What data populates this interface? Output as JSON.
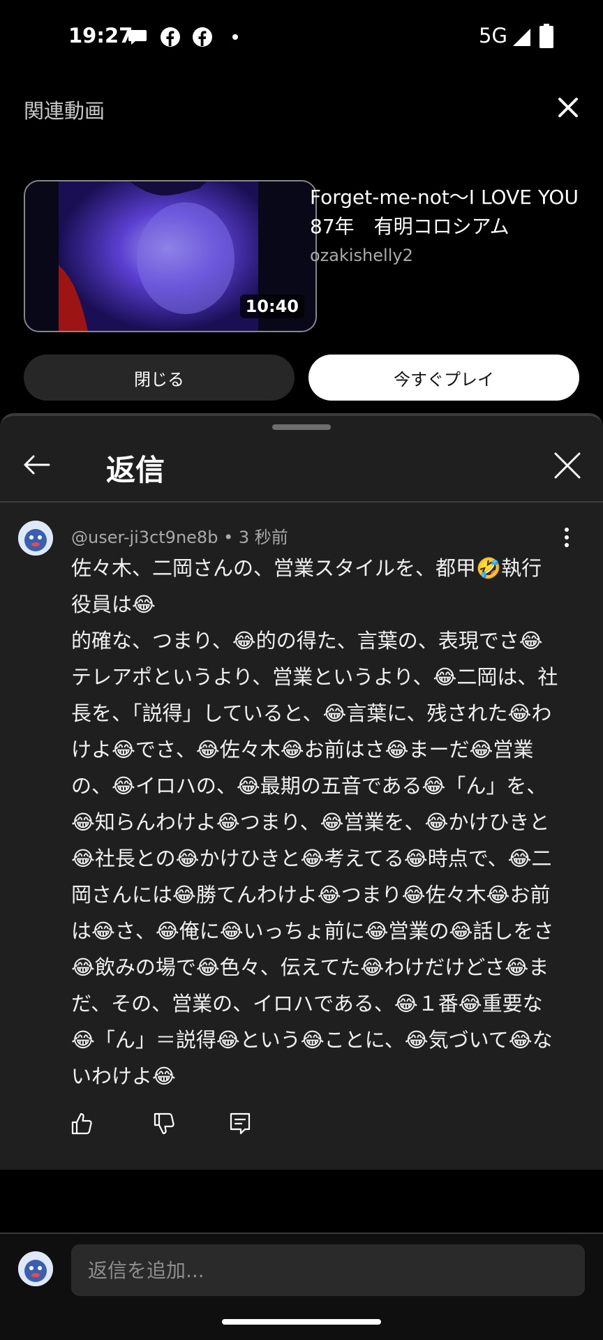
{
  "status_bar": {
    "time": "19:27",
    "notification_icons": [
      "chat-bubble-icon",
      "facebook-icon",
      "facebook-icon",
      "dot-icon"
    ],
    "network": "5G"
  },
  "related": {
    "title": "関連動画",
    "video": {
      "title": "Forget-me-not〜I LOVE YOU\n87年　有明コロシアム",
      "channel": "ozakishelly2",
      "duration": "10:40"
    },
    "close_button": "閉じる",
    "play_button": "今すぐプレイ"
  },
  "replies_sheet": {
    "title": "返信",
    "comment": {
      "meta": "@user-ji3ct9ne8b • 3 秒前",
      "text": "佐々木、二岡さんの、営業スタイルを、都甲🤣執行役員は😂\n的確な、つまり、😂的の得た、言葉の、表現でさ😂テレアポというより、営業というより、😂二岡は、社長を、「説得」していると、😂言葉に、残された😂わけよ😂でさ、😂佐々木😂お前はさ😂まーだ😂営業の、😂イロハの、😂最期の五音である😂「ん」を、😂知らんわけよ😂つまり、😂営業を、😂かけひきと😂社長との😂かけひきと😂考えてる😂時点で、😂二岡さんには😂勝てんわけよ😂つまり😂佐々木😂お前は😂さ、😂俺に😂いっちょ前に😂営業の😂話しをさ😂飲みの場で😂色々、伝えてた😂わけだけどさ😂まだ、その、営業の、イロハである、😂１番😂重要な😂「ん」＝説得😂という😂ことに、😂気づいて😂ないわけよ😂"
    }
  },
  "reply_bar": {
    "placeholder": "返信を追加..."
  },
  "colors": {
    "background": "#000000",
    "sheet": "#1f1f1f",
    "pill_light": "#ffffff",
    "pill_dark": "#272727"
  }
}
